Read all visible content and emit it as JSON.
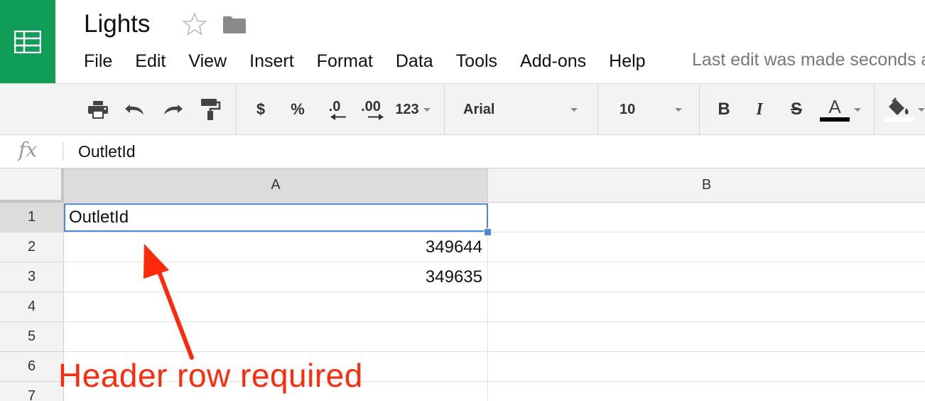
{
  "app": {
    "icon": "sheets-grid-icon",
    "brand_color": "#0f9d58",
    "doc_title": "Lights",
    "star_icon": "star-outline-icon",
    "folder_icon": "folder-icon"
  },
  "menu": {
    "items": [
      "File",
      "Edit",
      "View",
      "Insert",
      "Format",
      "Data",
      "Tools",
      "Add-ons",
      "Help"
    ],
    "last_edit": "Last edit was made seconds ago"
  },
  "toolbar": {
    "print_icon": "print-icon",
    "undo_icon": "undo-icon",
    "redo_icon": "redo-icon",
    "paint_format_icon": "paint-format-icon",
    "currency_label": "$",
    "percent_label": "%",
    "decrease_decimal_label": ".0",
    "increase_decimal_label": ".00",
    "more_formats_label": "123",
    "font_family": "Arial",
    "font_size": "10",
    "bold_label": "B",
    "italic_label": "I",
    "strike_label": "S",
    "text_color_label": "A",
    "fill_color_icon": "paint-bucket-icon"
  },
  "formula_bar": {
    "fx_label": "fx",
    "value": "OutletId"
  },
  "grid": {
    "columns": [
      "A",
      "B"
    ],
    "active_column": "A",
    "rows": [
      "1",
      "2",
      "3",
      "4",
      "5",
      "6",
      "7"
    ],
    "active_row": "1",
    "cells": {
      "A1": "OutletId",
      "A2": "349644",
      "A3": "349635"
    }
  },
  "annotation": {
    "text": "Header row required",
    "color": "#ff2a0c"
  }
}
